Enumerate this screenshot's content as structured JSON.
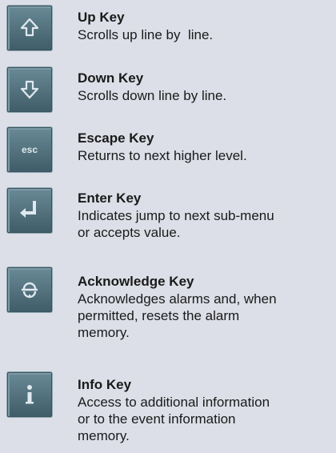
{
  "keys": [
    {
      "icon": "up-arrow-icon",
      "title": "Up Key",
      "lines": [
        "Scrolls up line by  line."
      ]
    },
    {
      "icon": "down-arrow-icon",
      "title": "Down Key",
      "lines": [
        "Scrolls down line by line."
      ]
    },
    {
      "icon": "esc-icon",
      "title": "Escape Key",
      "lines": [
        "Returns to next higher level."
      ]
    },
    {
      "icon": "enter-icon",
      "title": "Enter Key",
      "lines": [
        "Indicates jump to next sub-menu",
        "or accepts value."
      ]
    },
    {
      "icon": "acknowledge-icon",
      "title": "Acknowledge Key",
      "lines": [
        "Acknowledges alarms and, when",
        "permitted, resets the alarm",
        "memory."
      ]
    },
    {
      "icon": "info-icon",
      "title": "Info Key",
      "lines": [
        "Access to additional information",
        "or to the event information",
        "memory."
      ]
    }
  ],
  "key_glyph_esc": "esc",
  "colors": {
    "background": "#dcdfe7",
    "key_face": "#52717d",
    "glyph": "#dfe9ee"
  }
}
